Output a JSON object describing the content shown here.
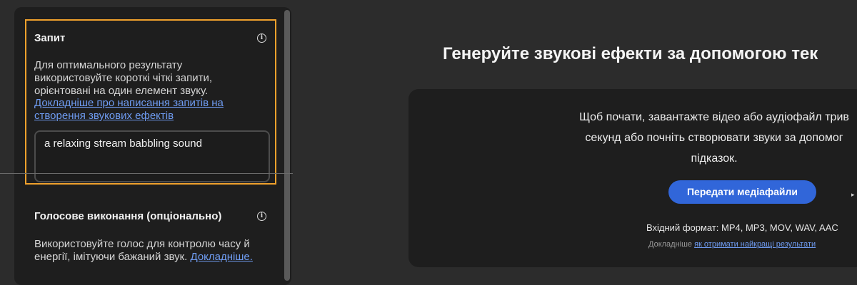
{
  "prompt_section": {
    "title": "Запит",
    "hint_lines": [
      "Для оптимального результату",
      "використовуйте короткі чіткі запити,",
      "орієнтовані на один елемент звуку."
    ],
    "link_lines": [
      "Докладніше про написання запитів на",
      "створення звукових ефектів"
    ],
    "input_value": "a relaxing stream babbling sound"
  },
  "voice_section": {
    "title": "Голосове виконання (опціонально)",
    "hint_line1": "Використовуйте голос для контролю часу й",
    "hint_line2_text": "енергії, імітуючи бажаний звук. ",
    "hint_link": "Докладніше."
  },
  "main": {
    "title": "Генеруйте звукові ефекти за допомогою тек",
    "drop_lines": [
      "Щоб почати, завантажте відео або аудіофайл трив",
      "секунд або почніть створювати звуки за допомог",
      "підказок."
    ],
    "upload_button": "Передати медіафайли",
    "format_text": "Вхідний формат: MP4, MP3, MOV, WAV, AAC",
    "tips_prefix": "Докладніше ",
    "tips_link": "як отримати найкращі результати"
  },
  "icons": {
    "info": "info-icon",
    "arrow": "chevron-right-icon"
  },
  "colors": {
    "accent_border": "#f0a12c",
    "button": "#3166d9",
    "link": "#6f9cf2"
  }
}
